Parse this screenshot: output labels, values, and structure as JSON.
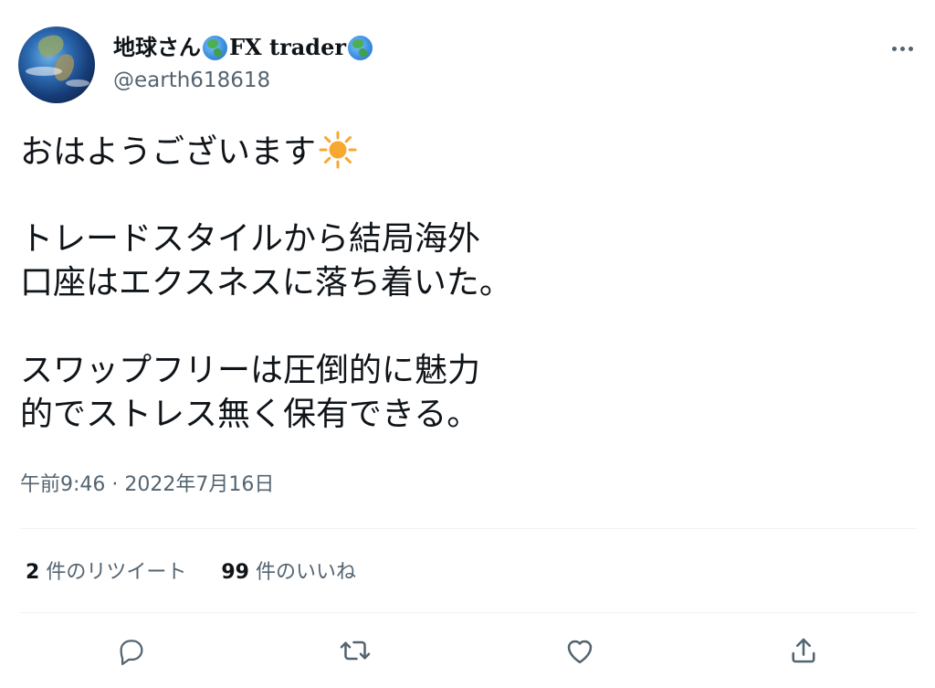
{
  "author": {
    "name_prefix": "地球さん",
    "name_middle": "FX trader",
    "handle": "@earth618618"
  },
  "tweet": {
    "lines": [
      "おはようございます",
      "",
      "トレードスタイルから結局海外",
      "口座はエクスネスに落ち着いた。",
      "",
      "スワップフリーは圧倒的に魅力",
      "的でストレス無く保有できる。"
    ],
    "timestamp": "午前9:46 · 2022年7月16日"
  },
  "stats": {
    "retweets_count": "2",
    "retweets_label": "件のリツイート",
    "likes_count": "99",
    "likes_label": "件のいいね"
  },
  "icons": {
    "avatar": "earth-globe-photo",
    "name_emoji": "globe-emoji",
    "sun": "sun-emoji",
    "more": "more-horizontal-icon",
    "reply": "reply-icon",
    "retweet": "retweet-icon",
    "like": "heart-icon",
    "share": "share-icon"
  },
  "colors": {
    "text_primary": "#0f1419",
    "text_secondary": "#536471",
    "divider": "#eff3f4",
    "sun": "#f7a830"
  }
}
